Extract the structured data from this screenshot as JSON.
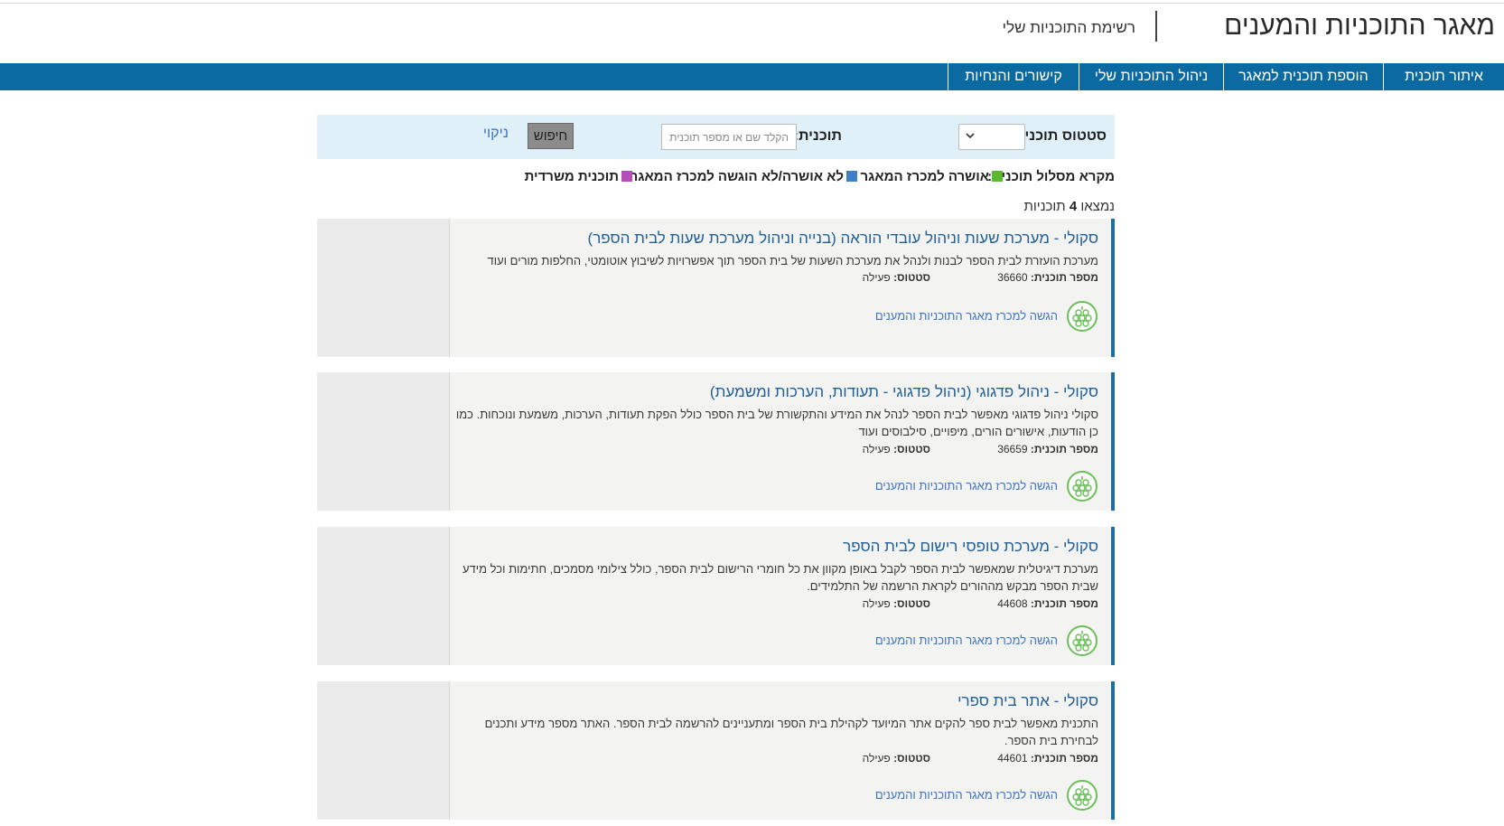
{
  "header": {
    "title": "מאגר התוכניות והמענים",
    "subtitle": "רשימת התוכניות שלי"
  },
  "nav": {
    "items": [
      {
        "label": "איתור תוכנית"
      },
      {
        "label": "הוספת תוכנית למאגר"
      },
      {
        "label": "ניהול התוכניות שלי"
      },
      {
        "label": "קישורים והנחיות"
      }
    ]
  },
  "search": {
    "status_label": "סטטוס תוכנית:",
    "program_label": "תוכנית:",
    "program_placeholder": "הקלד שם או מספר תוכנית",
    "search_button": "חיפוש",
    "clear_link": "ניקוי"
  },
  "legend": {
    "title": "מקרא מסלול תוכנית:",
    "items": [
      {
        "label": "אושרה למכרז המאגר",
        "color": "#5cb82e"
      },
      {
        "label": "לא אושרה/לא הוגשה למכרז המאגר",
        "color": "#3f7fc7"
      },
      {
        "label": "תוכנית משרדית",
        "color": "#b44fb8"
      }
    ]
  },
  "results": {
    "prefix": "נמצאו",
    "count": "4",
    "suffix": "תוכניות"
  },
  "labels": {
    "program_number": "מספר תוכנית:",
    "status": "סטטוס:",
    "action": "הגשה למכרז מאגר התוכניות והמענים"
  },
  "programs": [
    {
      "title": "סקולי - מערכת שעות וניהול עובדי הוראה (בנייה וניהול מערכת שעות לבית הספר)",
      "description": "מערכת הועזרת לבית הספר לבנות ולנהל את מערכת השעות של בית הספר תוך אפשרויות לשיבוץ אוטומטי, החלפות מורים ועוד",
      "number": "36660",
      "status": "פעילה"
    },
    {
      "title": "סקולי - ניהול פדגוגי (ניהול פדגוגי - תעודות, הערכות ומשמעת)",
      "description": "סקולי ניהול פדגוגי מאפשר לבית הספר לנהל את המידע והתקשורת של בית הספר כולל הפקת תעודות, הערכות, משמעת ונוכחות. כמו כן הודעות, אישורים הורים, מיפויים, סילבוסים ועוד",
      "number": "36659",
      "status": "פעילה"
    },
    {
      "title": "סקולי - מערכת טופסי רישום לבית הספר",
      "description": "מערכת דיגיטלית שמאפשר לבית הספר לקבל באופן מקוון את כל חומרי הרישום לבית הספר, כולל צילומי מסמכים, חתימות וכל מידע שבית הספר מבקש מההורים לקראת הרשמה של התלמידים.",
      "number": "44608",
      "status": "פעילה"
    },
    {
      "title": "סקולי - אתר בית ספרי",
      "description": "התכנית מאפשר לבית ספר להקים אתר המיועד לקהילת בית הספר ומתעניינים להרשמה לבית הספר. האתר מספר מידע ותכנים לבחירת בית הספר.",
      "number": "44601",
      "status": "פעילה"
    }
  ]
}
